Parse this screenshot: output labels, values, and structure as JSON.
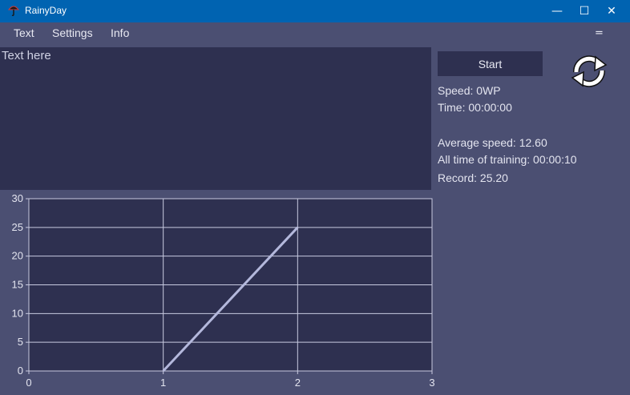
{
  "window": {
    "title": "RainyDay",
    "minimize": "—",
    "maximize": "☐",
    "close": "✕"
  },
  "menu": {
    "items": [
      "Text",
      "Settings",
      "Info"
    ],
    "overflow": "="
  },
  "editor": {
    "text": "Text here"
  },
  "controls": {
    "start_label": "Start"
  },
  "stats": {
    "speed": "Speed: 0WP",
    "time": "Time: 00:00:00",
    "average": "Average speed: 12.60",
    "all_time": "All time of training: 00:00:10",
    "record": "Record: 25.20"
  },
  "chart_data": {
    "type": "line",
    "x": [
      1,
      2
    ],
    "y": [
      0,
      25
    ],
    "xlim": [
      0,
      3
    ],
    "ylim": [
      0,
      30
    ],
    "x_ticks": [
      0,
      1,
      2,
      3
    ],
    "y_ticks": [
      0,
      5,
      10,
      15,
      20,
      25,
      30
    ],
    "grid": true,
    "title": "",
    "xlabel": "",
    "ylabel": ""
  },
  "colors": {
    "titlebar": "#0063b1",
    "background": "#4b4f72",
    "panel": "#2e3050",
    "line": "#b4b8dc",
    "grid": "#c8cae0"
  }
}
